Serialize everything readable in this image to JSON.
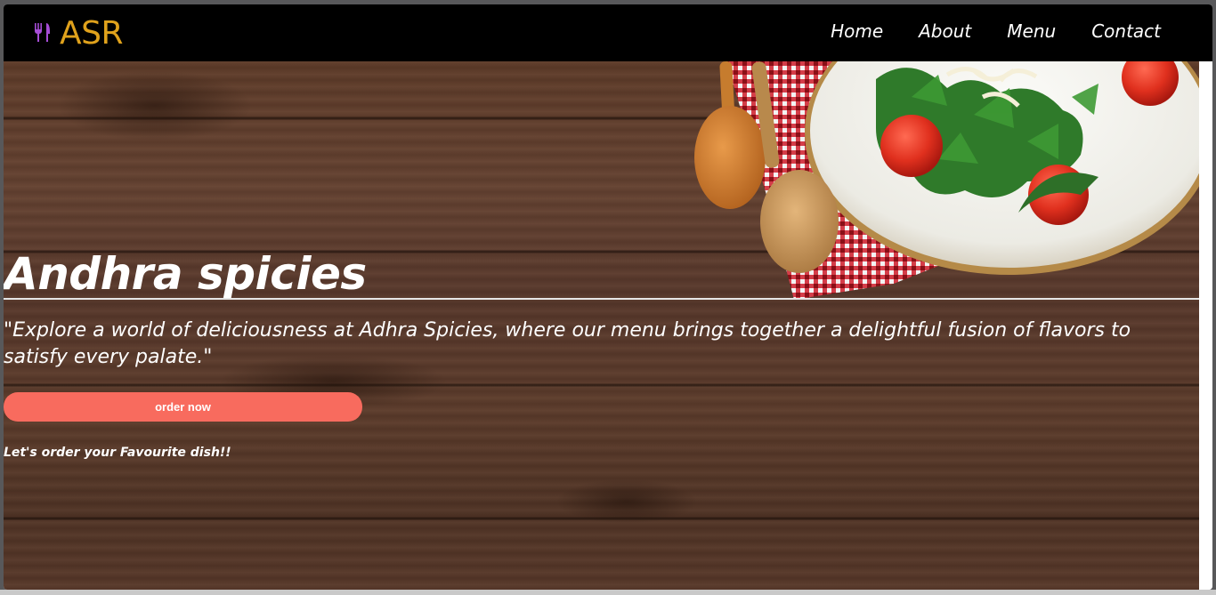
{
  "brand": {
    "name": "ASR",
    "icon": "fork-knife-icon",
    "color": "#e0a21c",
    "icon_color": "#a64dd6"
  },
  "nav": {
    "items": [
      {
        "label": "Home"
      },
      {
        "label": "About"
      },
      {
        "label": "Menu"
      },
      {
        "label": "Contact"
      }
    ]
  },
  "hero": {
    "title": "Andhra spicies",
    "quote": "\"Explore a world of deliciousness at Adhra Spicies, where our menu brings together a delightful fusion of flavors to satisfy every palate.\"",
    "order_button": "order now",
    "cta": "Let's order your Favourite dish!!",
    "accent_color": "#f86b5e"
  }
}
